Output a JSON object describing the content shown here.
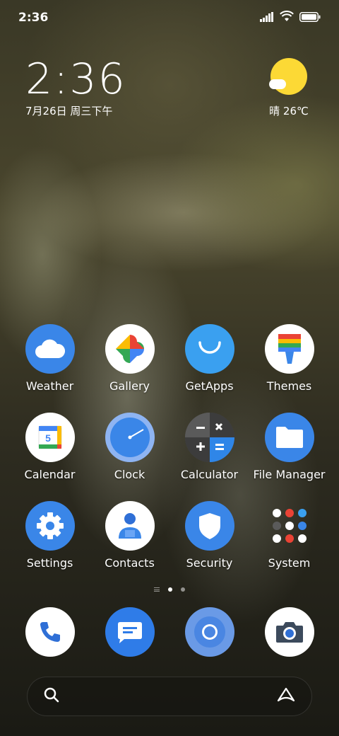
{
  "status_bar": {
    "time": "2:36"
  },
  "clock_widget": {
    "time": "2:36",
    "date": "7月26日 周三下午"
  },
  "weather_widget": {
    "text": "晴 26℃",
    "icon": "sunny-partly-cloudy-icon"
  },
  "apps": [
    [
      {
        "label": "Weather",
        "icon": "weather-icon",
        "color": "#3a86e8"
      },
      {
        "label": "Gallery",
        "icon": "gallery-icon",
        "color": "#ffffff"
      },
      {
        "label": "GetApps",
        "icon": "getapps-icon",
        "color": "#3aa0f0"
      },
      {
        "label": "Themes",
        "icon": "themes-icon",
        "color": "#ffffff"
      }
    ],
    [
      {
        "label": "Calendar",
        "icon": "calendar-icon",
        "color": "#ffffff"
      },
      {
        "label": "Clock",
        "icon": "clock-icon",
        "color": "#8eb4f2"
      },
      {
        "label": "Calculator",
        "icon": "calculator-icon",
        "color": "#4a4a4a"
      },
      {
        "label": "File Manager",
        "icon": "folder-icon",
        "color": "#3a86e8"
      }
    ],
    [
      {
        "label": "Settings",
        "icon": "settings-icon",
        "color": "#3a86e8"
      },
      {
        "label": "Contacts",
        "icon": "contacts-icon",
        "color": "#ffffff"
      },
      {
        "label": "Security",
        "icon": "security-icon",
        "color": "#3a86e8"
      },
      {
        "label": "System",
        "icon": "system-folder-icon",
        "color": "transparent"
      }
    ]
  ],
  "calendar_day": "5",
  "dock": [
    {
      "name": "phone",
      "icon": "phone-icon",
      "color": "#ffffff"
    },
    {
      "name": "messages",
      "icon": "messages-icon",
      "color": "#2f7ce8"
    },
    {
      "name": "browser",
      "icon": "browser-icon",
      "color": "#6a9ae6"
    },
    {
      "name": "camera",
      "icon": "camera-icon",
      "color": "#ffffff"
    }
  ],
  "page_indicator": {
    "pages": 2,
    "current": 1
  },
  "colors": {
    "accent_blue": "#3a86e8",
    "sun_yellow": "#fcd935"
  }
}
